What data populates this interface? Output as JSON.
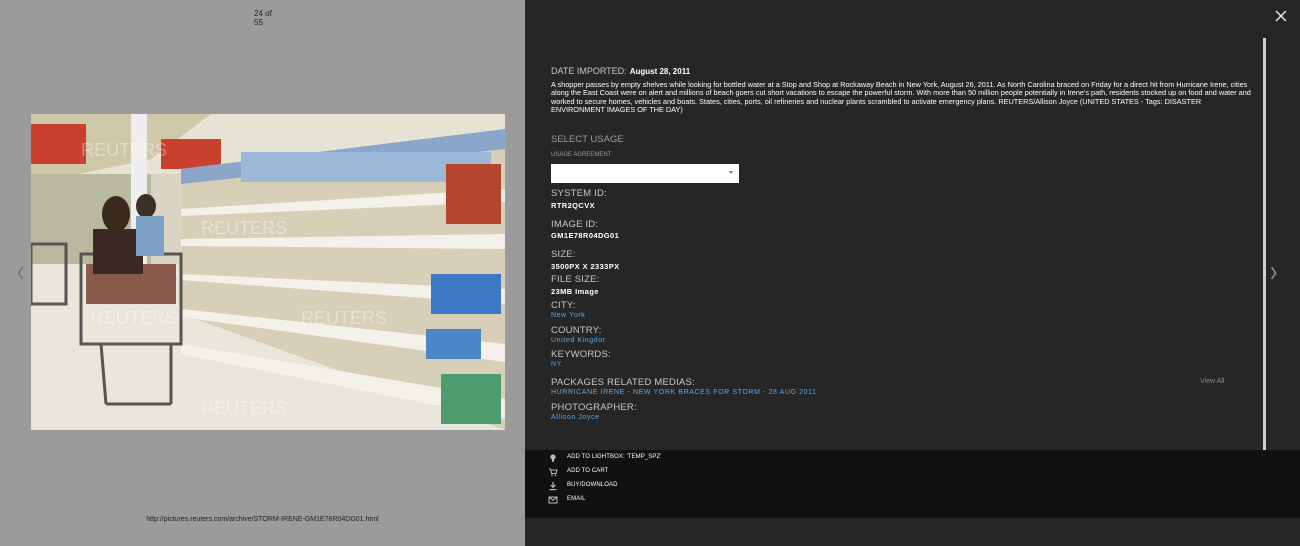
{
  "viewer": {
    "counter_top": "24 of",
    "counter_bottom": "55",
    "url": "http://pictures.reuters.com/archive/STORM-IRENE-GM1E78R04DG01.html",
    "prev_icon": "‹",
    "next_icon": "›",
    "watermark": "REUTERS"
  },
  "details": {
    "date_label": "DATE IMPORTED:",
    "date_value": "August 28, 2011",
    "caption": "A shopper passes by empty shelves while looking for bottled water at a Stop and Shop at Rockaway Beach in New York, August 26, 2011. As North Carolina braced on Friday for a direct hit from Hurricane Irene, cities along the East Coast were on alert and millions of beach goers cut short vacations to escape the powerful storm. With more than 50 million people potentially in Irene's path, residents stocked up on food and water and worked to secure homes, vehicles and boats. States, cities, ports, oil refineries and nuclear plants scrambled to activate emergency plans. REUTERS/Allison Joyce (UNITED STATES - Tags: DISASTER ENVIRONMENT IMAGES OF THE DAY)",
    "select_usage": "SELECT USAGE",
    "usage_agreement": "USAGE AGREEMENT",
    "usage_value": "",
    "system_id_label": "SYSTEM ID:",
    "system_id": "RTR2QCVX",
    "image_id_label": "IMAGE ID:",
    "image_id": "GM1E78R04DG01",
    "size_label": "SIZE:",
    "size": "3500PX X 2333PX",
    "file_size_label": "FILE SIZE:",
    "file_size": "23MB Image",
    "city_label": "CITY:",
    "city": "New York",
    "country_label": "COUNTRY:",
    "country": "United Kingdor",
    "keywords_label": "KEYWORDS:",
    "keywords": "NY",
    "packages_label": "PACKAGES RELATED MEDIAS:",
    "package": "HURRICANE IRENE - NEW YORK BRACES FOR STORM - 28 AUG 2011",
    "view_all": "View All",
    "photographer_label": "PHOTOGRAPHER:",
    "photographer": "Allison Joyce"
  },
  "actions": [
    {
      "label": "ADD TO LIGHTBOX: 'TEMP_SPZ'",
      "icon": "lightbulb-icon"
    },
    {
      "label": "ADD TO CART",
      "icon": "cart-icon"
    },
    {
      "label": "BUY/DOWNLOAD",
      "icon": "download-icon"
    },
    {
      "label": "EMAIL",
      "icon": "email-icon"
    }
  ],
  "colors": {
    "panel": "#262626",
    "actionbar": "#111111",
    "link": "#5ba8e6",
    "viewer_bg": "#9b9b9b"
  }
}
